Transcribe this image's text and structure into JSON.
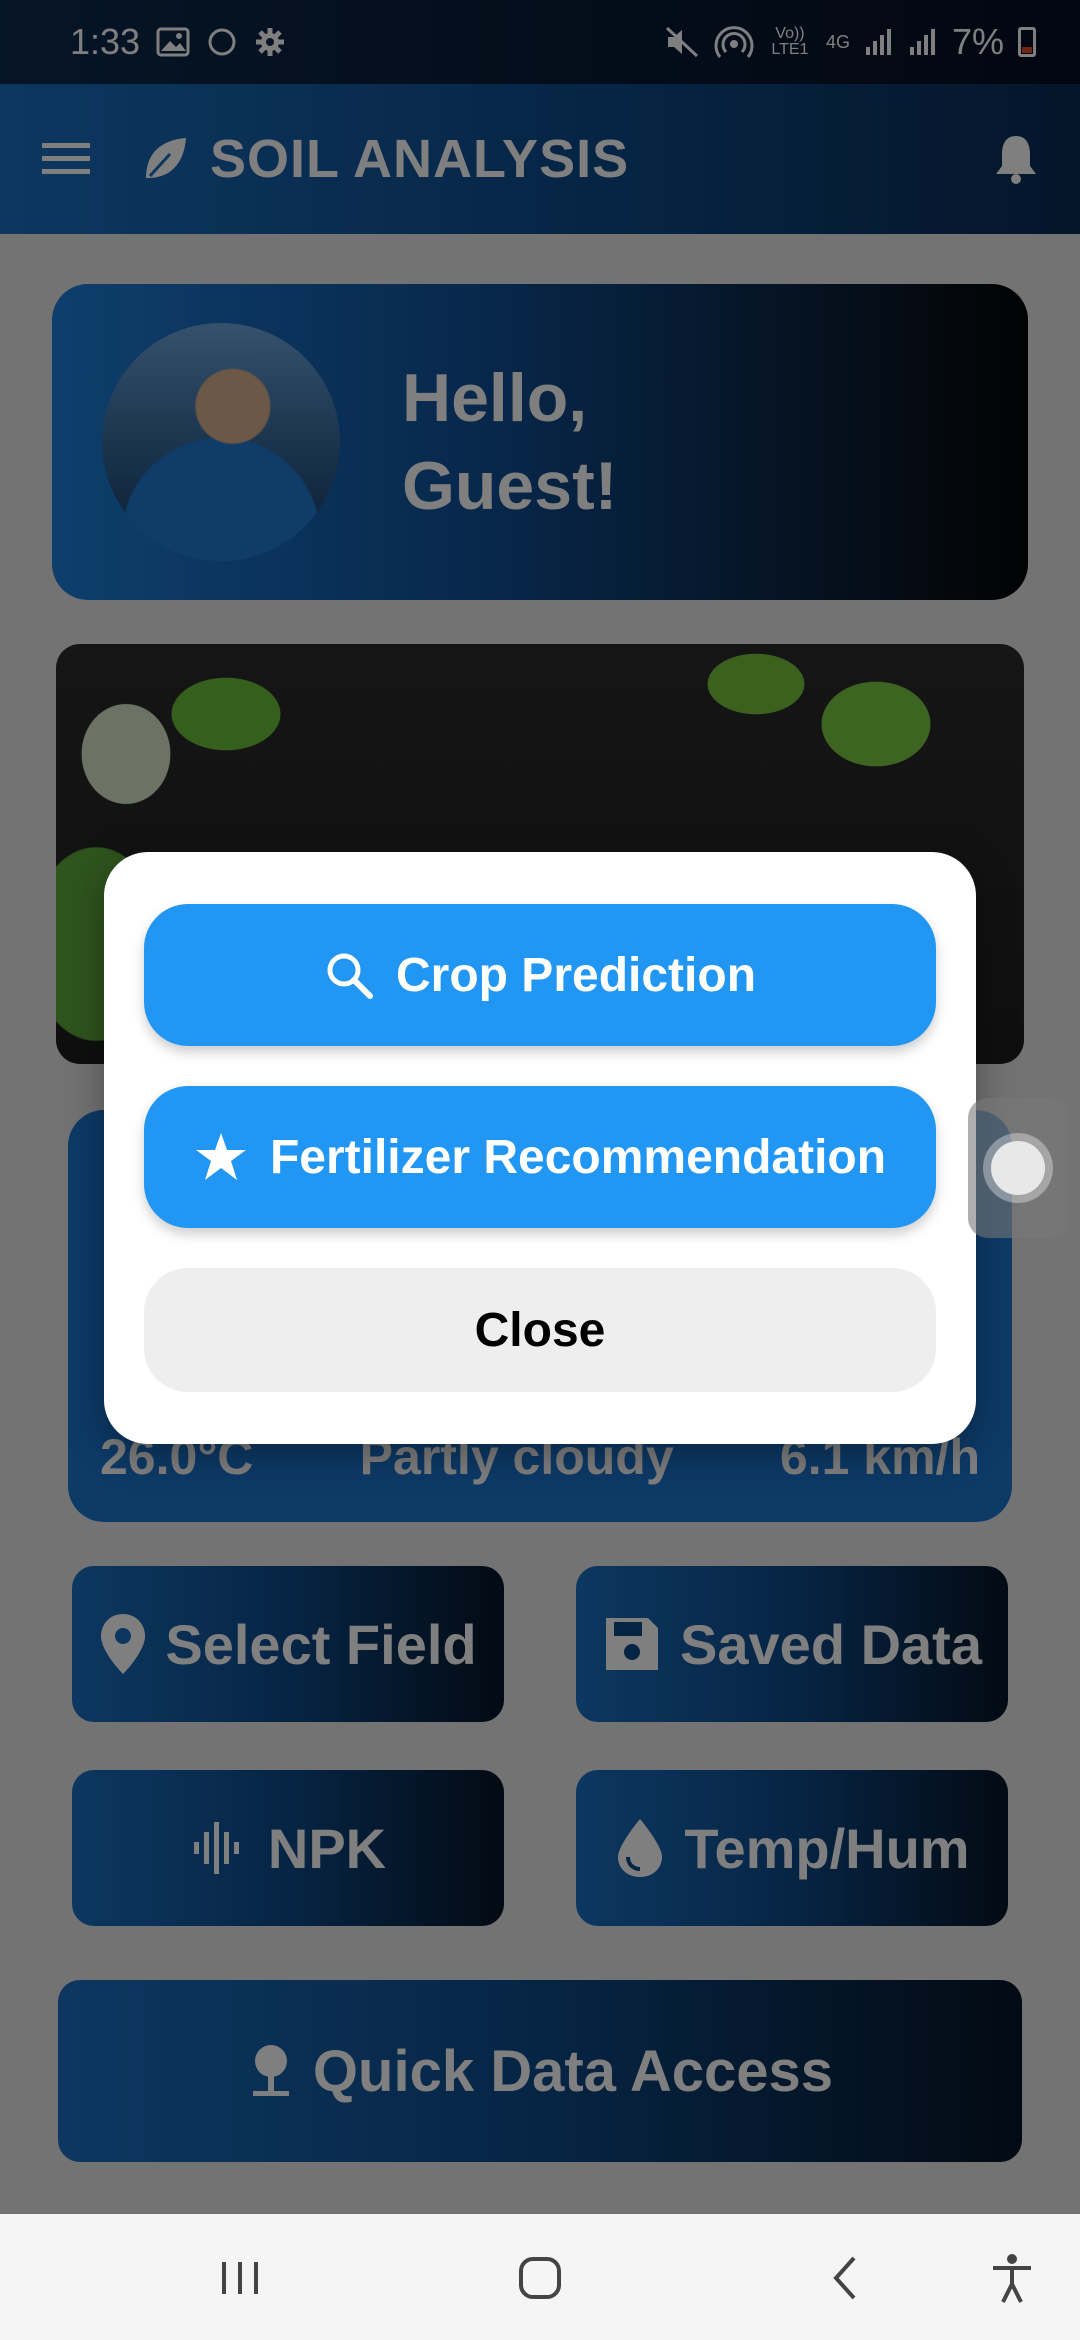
{
  "status_bar": {
    "time": "1:33",
    "battery": "7%",
    "network_label_1": "Vo)) LTE1",
    "network_label_2": "4G",
    "icons": [
      "gallery-icon",
      "circle-icon",
      "settings-icon",
      "mute-icon",
      "hotspot-icon",
      "signal-icon",
      "signal-icon",
      "battery-icon"
    ]
  },
  "app_bar": {
    "title": "SOIL ANALYSIS",
    "menu_icon": "menu-icon",
    "logo_icon": "leaf-icon",
    "bell_icon": "bell-icon"
  },
  "greeting": {
    "line1": "Hello,",
    "line2": "Guest!"
  },
  "weather": {
    "temperature": "26.0°C",
    "condition": "Partly cloudy",
    "wind": "6.1 km/h"
  },
  "tiles": {
    "select_field": "Select Field",
    "saved_data": "Saved Data",
    "npk": "NPK",
    "temp_hum": "Temp/Hum",
    "quick_access": "Quick Data Access"
  },
  "dialog": {
    "crop_prediction": "Crop Prediction",
    "fertilizer_recommendation": "Fertilizer Recommendation",
    "close": "Close"
  },
  "colors": {
    "primary_button": "#2196f3",
    "app_bar_start": "#1a6fc1",
    "app_bar_end": "#0a2b54"
  }
}
